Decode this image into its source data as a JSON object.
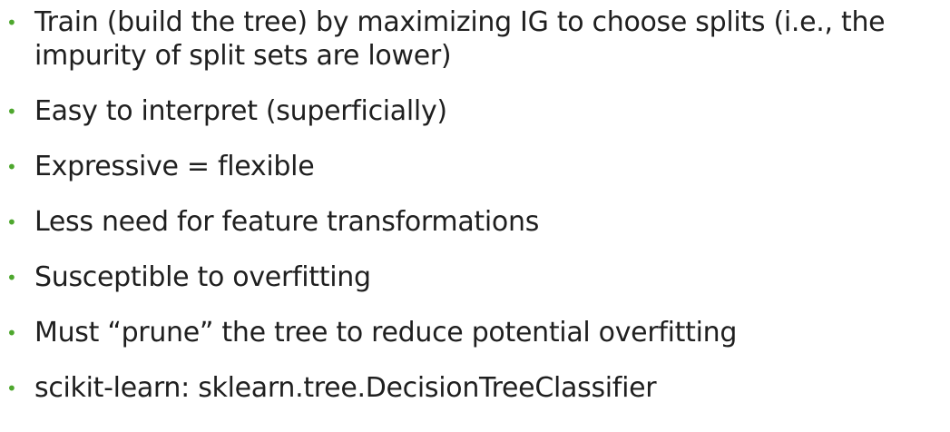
{
  "slide": {
    "bullets": [
      {
        "lines": [
          "Train (build the tree) by maximizing IG to choose splits (i.e., the",
          "impurity of split sets are lower)"
        ]
      },
      {
        "lines": [
          "Easy to interpret (superficially)"
        ]
      },
      {
        "lines": [
          "Expressive = flexible"
        ]
      },
      {
        "lines": [
          "Less need for feature transformations"
        ]
      },
      {
        "lines": [
          "Susceptible to overfitting"
        ]
      },
      {
        "lines": [
          "Must “prune” the tree to reduce potential overfitting"
        ]
      },
      {
        "lines": [
          "scikit-learn: sklearn.tree.DecisionTreeClassifier"
        ]
      }
    ],
    "bullet_symbol": "•",
    "bullet_color": "#4ea72e",
    "text_color": "#1f1f1f",
    "background_color": "#ffffff"
  }
}
